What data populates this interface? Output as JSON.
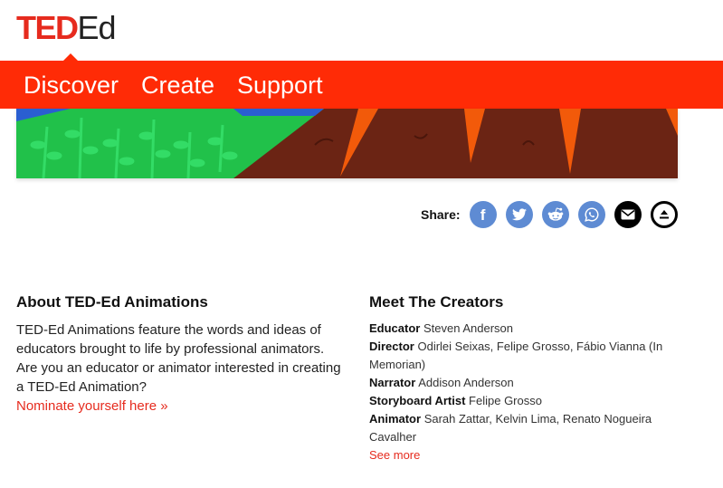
{
  "logo": {
    "ted": "TED",
    "ed": "Ed"
  },
  "nav": {
    "items": [
      {
        "label": "Discover"
      },
      {
        "label": "Create"
      },
      {
        "label": "Support"
      }
    ]
  },
  "share": {
    "label": "Share:",
    "buttons": [
      {
        "icon": "facebook-icon",
        "glyph": "f"
      },
      {
        "icon": "twitter-icon"
      },
      {
        "icon": "reddit-icon"
      },
      {
        "icon": "whatsapp-icon"
      },
      {
        "icon": "email-icon"
      },
      {
        "icon": "share-more-icon"
      }
    ]
  },
  "about": {
    "title": "About TED-Ed Animations",
    "body": "TED-Ed Animations feature the words and ideas of educators brought to life by professional animators. Are you an educator or animator interested in creating a TED-Ed Animation?",
    "link": "Nominate yourself here »"
  },
  "creators": {
    "title": "Meet The Creators",
    "roles": [
      {
        "role": "Educator",
        "names": "Steven Anderson"
      },
      {
        "role": "Director",
        "names": "Odirlei Seixas, Felipe Grosso, Fábio Vianna (In Memorian)"
      },
      {
        "role": "Narrator",
        "names": "Addison Anderson"
      },
      {
        "role": "Storyboard Artist",
        "names": "Felipe Grosso"
      },
      {
        "role": "Animator",
        "names": "Sarah Zattar, Kelvin Lima, Renato Nogueira Cavalher"
      }
    ],
    "see_more": "See more"
  },
  "colors": {
    "brand_red": "#e62b1e",
    "nav_red": "#ff2b06",
    "share_blue": "#5e8bd3"
  }
}
